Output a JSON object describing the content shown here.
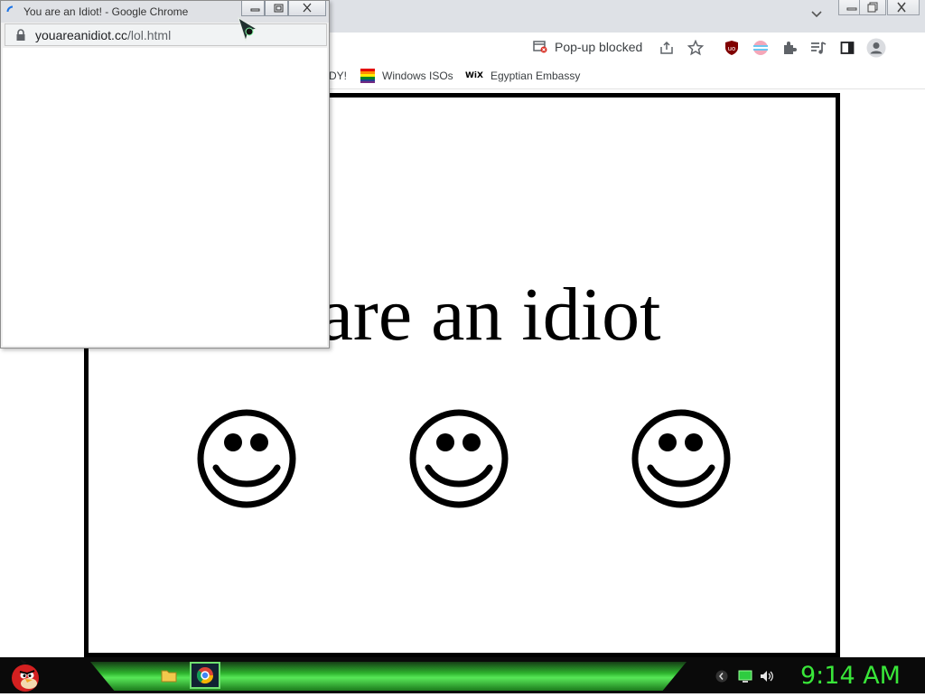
{
  "popup": {
    "title": "You are an Idiot! - Google Chrome",
    "url_host": "youareanidiot.cc",
    "url_path": "/lol.html"
  },
  "toolbar": {
    "popup_blocked_label": "Pop-up blocked"
  },
  "bookmarks": [
    {
      "label": "DY!",
      "icon": "bookmark-fragment"
    },
    {
      "label": "Windows ISOs",
      "icon": "rainbow-flag-icon"
    },
    {
      "label": "Egyptian Embassy",
      "icon": "wix-icon"
    }
  ],
  "page": {
    "headline": "are an idiot"
  },
  "taskbar": {
    "clock": "9:14 AM"
  },
  "icons": [
    "spinner-icon",
    "lock-icon",
    "minimize-icon",
    "maximize-icon",
    "close-icon",
    "popup-blocked-icon",
    "share-icon",
    "star-icon",
    "ublock-icon",
    "extension-icon",
    "puzzle-icon",
    "media-icon",
    "side-panel-icon",
    "profile-icon",
    "chevron-down-icon",
    "angry-bird-icon",
    "folder-icon",
    "chrome-icon",
    "sound-icon",
    "network-icon",
    "back-icon"
  ],
  "colors": {
    "clock_green": "#39e639",
    "taskbar_green": "#2fb52f"
  }
}
